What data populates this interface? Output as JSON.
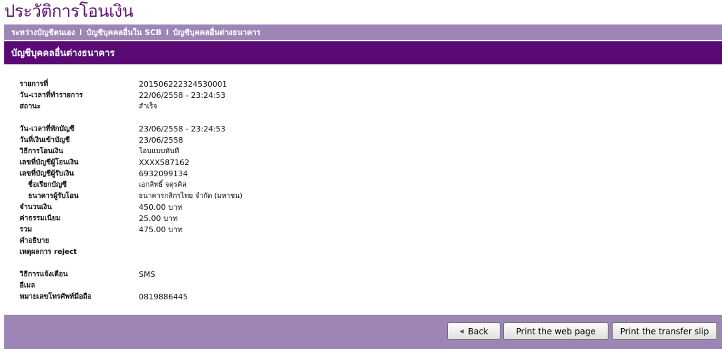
{
  "page_title": "ประวัติการโอนเงิน",
  "nav": {
    "items": [
      "ระหว่างบัญชีตนเอง",
      "บัญชีบุคคลอื่นใน SCB",
      "บัญชีบุคคลอื่นต่างธนาคาร"
    ],
    "separator": "I"
  },
  "section_title": "บัญชีบุคคลอื่นต่างธนาคาร",
  "details": {
    "txn_no": {
      "label": "รายการที่",
      "value": "201506222324530001"
    },
    "txn_datetime": {
      "label": "วัน-เวลาที่ทำรายการ",
      "value": "22/06/2558 - 23:24:53"
    },
    "status": {
      "label": "สถานะ",
      "value": "สำเร็จ"
    },
    "debit_datetime": {
      "label": "วัน-เวลาที่หักบัญชี",
      "value": "23/06/2558 - 23:24:53"
    },
    "credit_date": {
      "label": "วันที่เงินเข้าบัญชี",
      "value": "23/06/2558"
    },
    "transfer_method": {
      "label": "วิธีการโอนเงิน",
      "value": "โอนแบบทันที"
    },
    "from_account": {
      "label": "เลขที่บัญชีผู้โอนเงิน",
      "value": "XXXX587162"
    },
    "to_account": {
      "label": "เลขที่บัญชีผู้รับเงิน",
      "value": "6932099134"
    },
    "account_name": {
      "label": "ชื่อเรียกบัญชี",
      "value": "เอกสิทธิ์ จตุรคิล"
    },
    "receiving_bank": {
      "label": "ธนาคารผู้รับโอน",
      "value": "ธนาคารกสิกรไทย จำกัด (มหาชน)"
    },
    "amount": {
      "label": "จำนวนเงิน",
      "value": "450.00  บาท"
    },
    "fee": {
      "label": "ค่าธรรมเนียม",
      "value": "25.00  บาท"
    },
    "total": {
      "label": "รวม",
      "value": "475.00  บาท"
    },
    "description": {
      "label": "คำอธิบาย",
      "value": ""
    },
    "reject_reason": {
      "label": "เหตุผลการ reject",
      "value": ""
    },
    "notify_method": {
      "label": "วิธีการแจ้งเตือน",
      "value": "SMS"
    },
    "email": {
      "label": "อีเมล",
      "value": ""
    },
    "mobile": {
      "label": "หมายเลขโทรศัพท์มือถือ",
      "value": "0819886445"
    }
  },
  "buttons": {
    "back": "Back",
    "print_page": "Print the web page",
    "print_slip": "Print the transfer slip"
  },
  "colors": {
    "title": "#5a1370",
    "nav_bar": "#9d86b6",
    "section_header": "#5a0a75"
  }
}
